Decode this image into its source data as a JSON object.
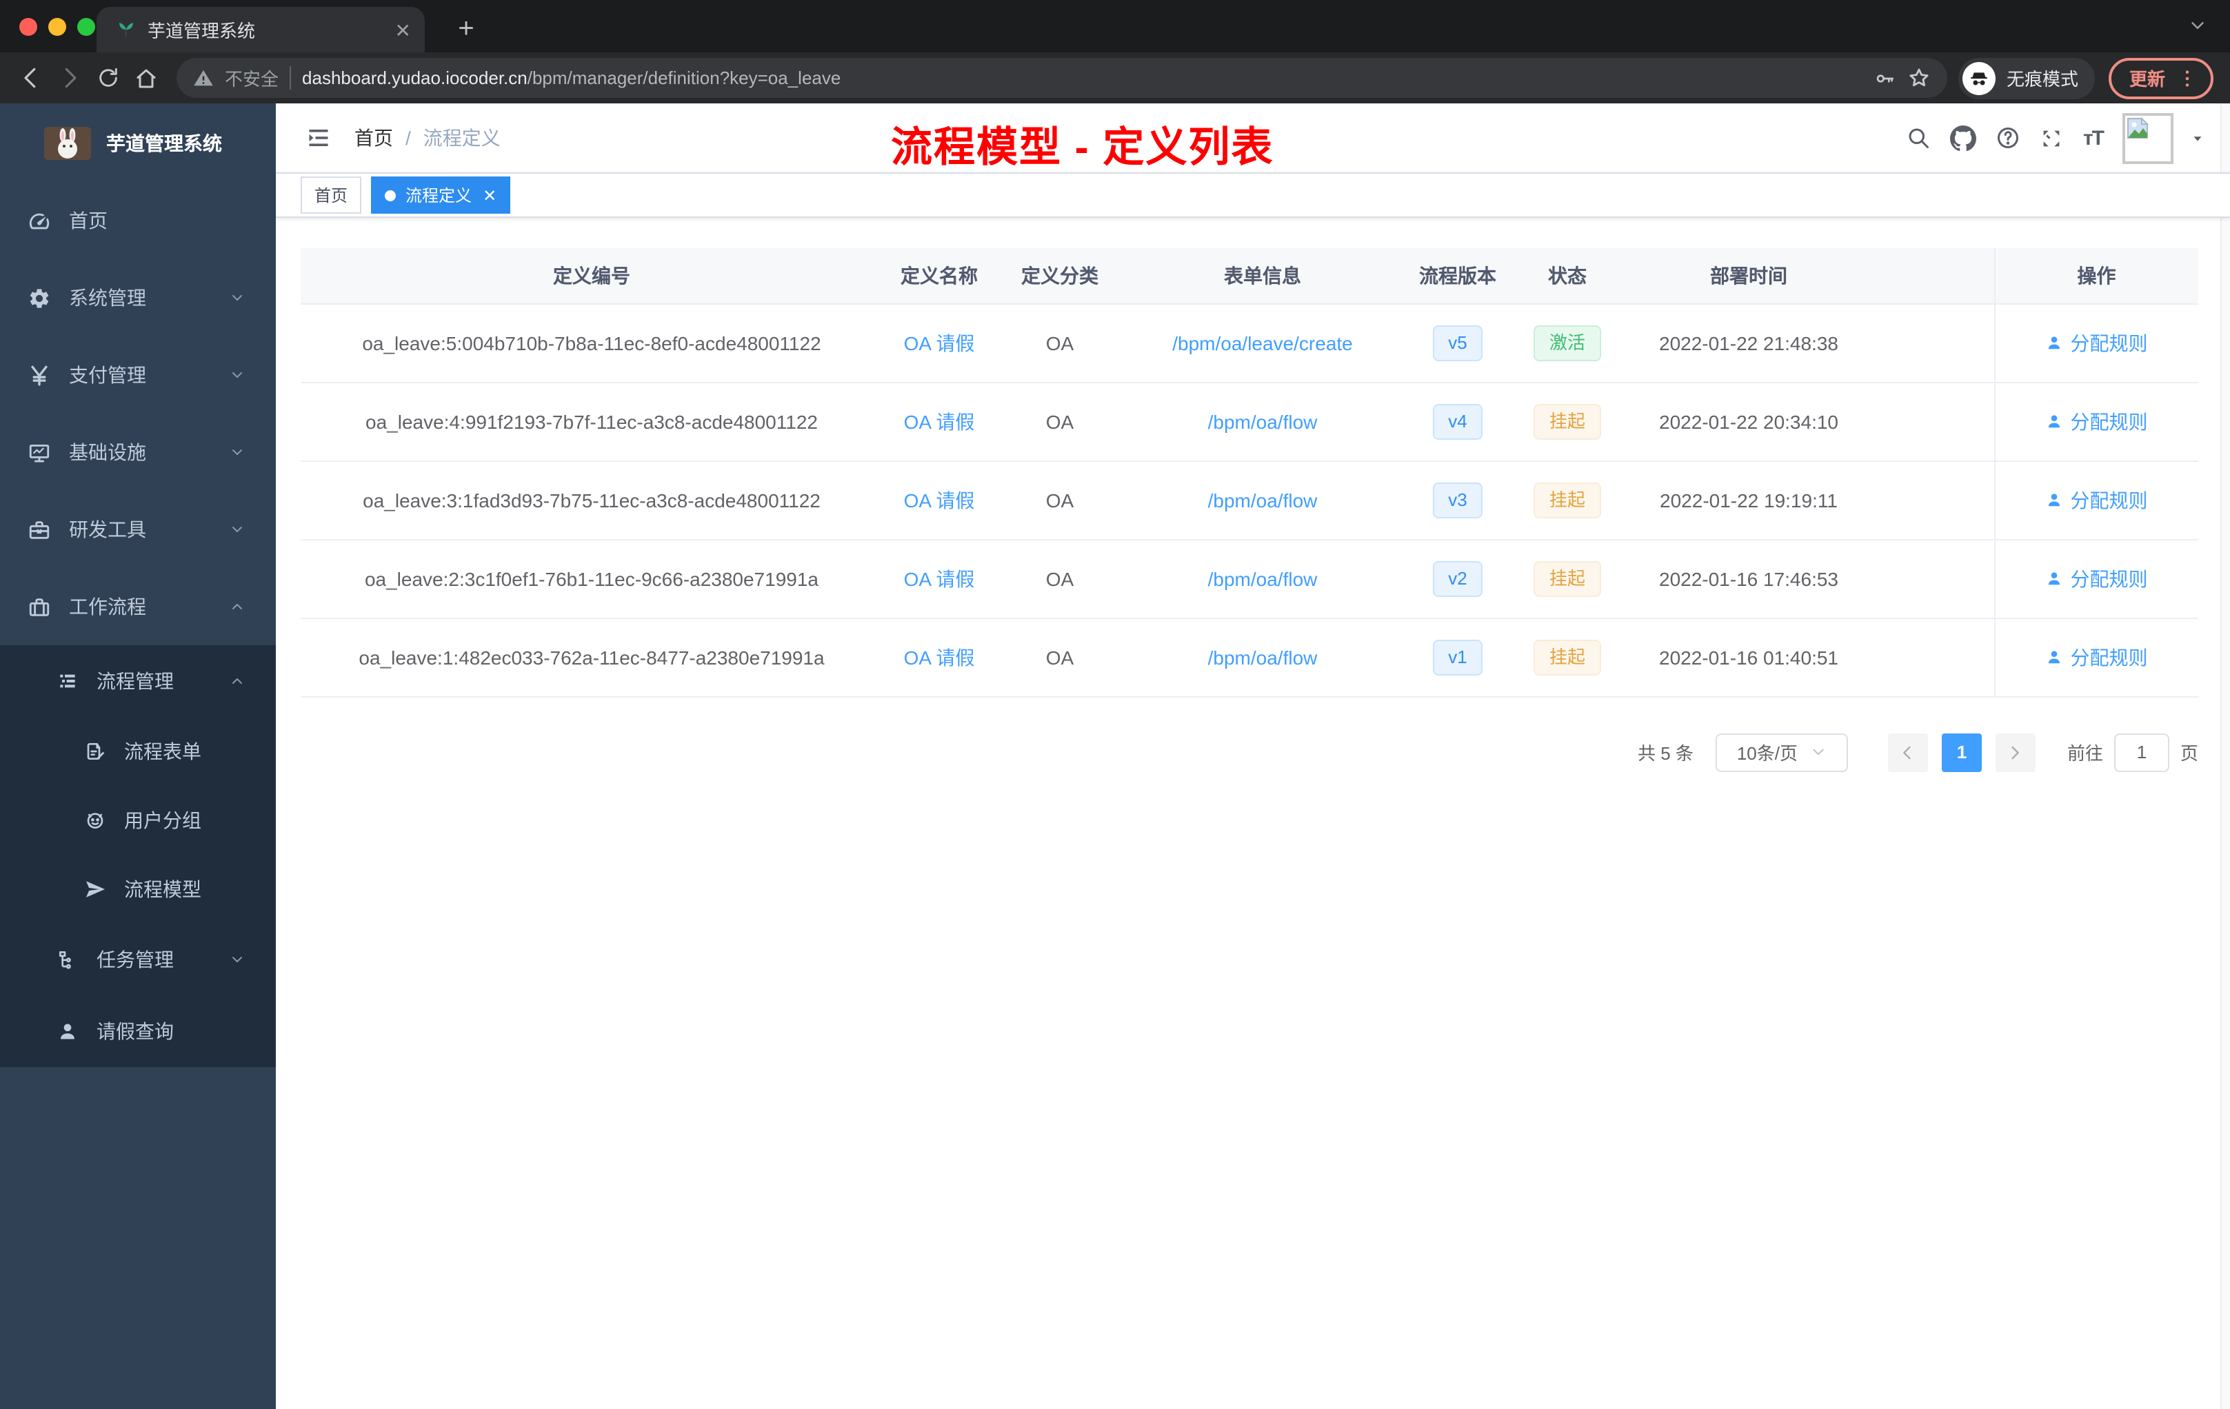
{
  "colors": {
    "accent": "#409eff",
    "active_tag": "#2d8cf0",
    "sidebar_bg": "#304156",
    "sidebar_submenu_bg": "#1f2d3d",
    "sidebar_text": "#bfcbd9",
    "annotation_red": "#fe0000",
    "success_text": "#3dbd73",
    "warning_text": "#e6a23c"
  },
  "browser": {
    "traffic_lights": [
      "#ff5f57",
      "#febc2e",
      "#28c840"
    ],
    "tab_title": "芋道管理系统",
    "security_label": "不安全",
    "url_domain": "dashboard.yudao.iocoder.cn",
    "url_path": "/bpm/manager/definition?key=oa_leave",
    "incognito_label": "无痕模式",
    "update_label": "更新"
  },
  "sidebar": {
    "logo_title": "芋道管理系统",
    "items": [
      {
        "label": "首页",
        "icon": "dashboard",
        "level": 1,
        "chevron": "",
        "dark": false
      },
      {
        "label": "系统管理",
        "icon": "gear",
        "level": 1,
        "chevron": "down",
        "dark": false
      },
      {
        "label": "支付管理",
        "icon": "yen",
        "level": 1,
        "chevron": "down",
        "dark": false
      },
      {
        "label": "基础设施",
        "icon": "monitor",
        "level": 1,
        "chevron": "down",
        "dark": false
      },
      {
        "label": "研发工具",
        "icon": "toolbox",
        "level": 1,
        "chevron": "down",
        "dark": false
      },
      {
        "label": "工作流程",
        "icon": "suitcase",
        "level": 1,
        "chevron": "up",
        "dark": false
      },
      {
        "label": "流程管理",
        "icon": "list",
        "level": 2,
        "chevron": "up",
        "dark": true
      },
      {
        "label": "流程表单",
        "icon": "form",
        "level": 3,
        "chevron": "",
        "dark": true
      },
      {
        "label": "用户分组",
        "icon": "robot",
        "level": 3,
        "chevron": "",
        "dark": true
      },
      {
        "label": "流程模型",
        "icon": "send",
        "level": 3,
        "chevron": "",
        "dark": true
      },
      {
        "label": "任务管理",
        "icon": "tree",
        "level": 2,
        "chevron": "down",
        "dark": true
      },
      {
        "label": "请假查询",
        "icon": "person",
        "level": 2,
        "chevron": "",
        "dark": true
      }
    ]
  },
  "header": {
    "breadcrumb": [
      "首页",
      "流程定义"
    ],
    "annotation": {
      "text": "流程模型 - 定义列表"
    }
  },
  "tags_view": [
    {
      "label": "首页",
      "active": false,
      "closable": false
    },
    {
      "label": "流程定义",
      "active": true,
      "closable": true
    }
  ],
  "table": {
    "columns": [
      "定义编号",
      "定义名称",
      "定义分类",
      "表单信息",
      "流程版本",
      "状态",
      "部署时间",
      "操作"
    ],
    "action_label": "分配规则",
    "rows": [
      {
        "id": "oa_leave:5:004b710b-7b8a-11ec-8ef0-acde48001122",
        "name": "OA 请假",
        "category": "OA",
        "form": "/bpm/oa/leave/create",
        "version": "v5",
        "status": "激活",
        "status_type": "success",
        "time": "2022-01-22 21:48:38"
      },
      {
        "id": "oa_leave:4:991f2193-7b7f-11ec-a3c8-acde48001122",
        "name": "OA 请假",
        "category": "OA",
        "form": "/bpm/oa/flow",
        "version": "v4",
        "status": "挂起",
        "status_type": "warning",
        "time": "2022-01-22 20:34:10"
      },
      {
        "id": "oa_leave:3:1fad3d93-7b75-11ec-a3c8-acde48001122",
        "name": "OA 请假",
        "category": "OA",
        "form": "/bpm/oa/flow",
        "version": "v3",
        "status": "挂起",
        "status_type": "warning",
        "time": "2022-01-22 19:19:11"
      },
      {
        "id": "oa_leave:2:3c1f0ef1-76b1-11ec-9c66-a2380e71991a",
        "name": "OA 请假",
        "category": "OA",
        "form": "/bpm/oa/flow",
        "version": "v2",
        "status": "挂起",
        "status_type": "warning",
        "time": "2022-01-16 17:46:53"
      },
      {
        "id": "oa_leave:1:482ec033-762a-11ec-8477-a2380e71991a",
        "name": "OA 请假",
        "category": "OA",
        "form": "/bpm/oa/flow",
        "version": "v1",
        "status": "挂起",
        "status_type": "warning",
        "time": "2022-01-16 01:40:51"
      }
    ]
  },
  "pagination": {
    "total": "共 5 条",
    "page_size": "10条/页",
    "current_page": "1",
    "goto_label": "前往",
    "goto_value": "1",
    "page_unit": "页"
  }
}
